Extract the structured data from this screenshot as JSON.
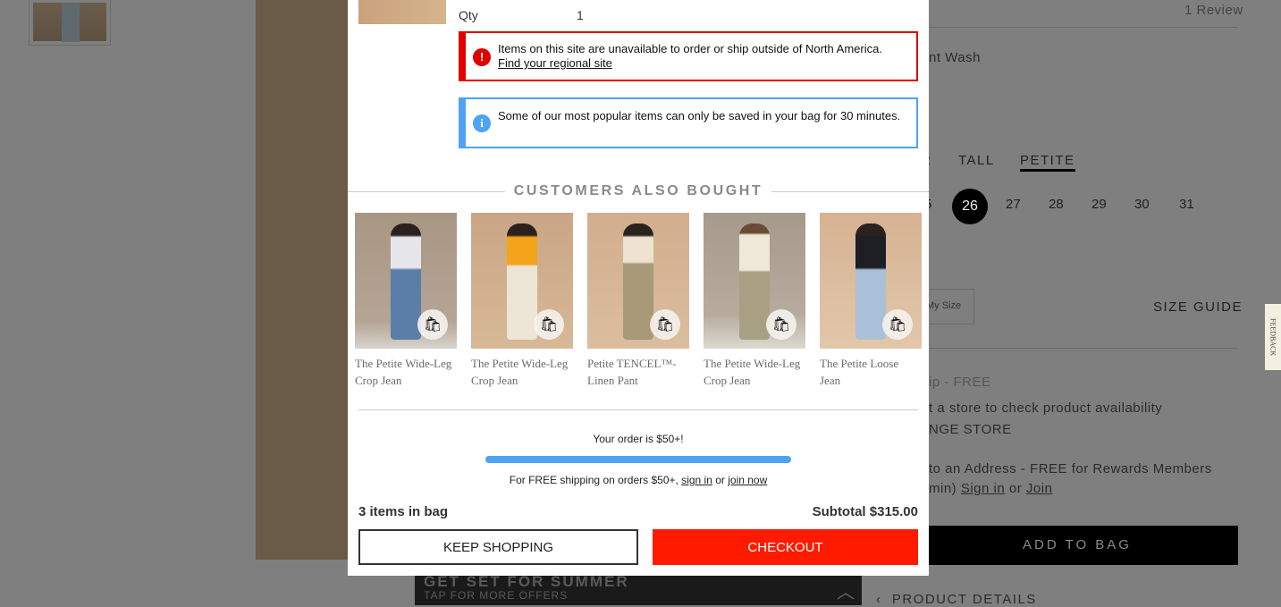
{
  "background": {
    "review": "1 Review",
    "color_name": "nt Wash",
    "fit_tabs": [
      "R",
      "TALL",
      "PETITE"
    ],
    "selected_fit": "PETITE",
    "sizes": [
      "5",
      "26",
      "27",
      "28",
      "29",
      "30",
      "31"
    ],
    "selected_size": "26",
    "find_my_size": "My Size",
    "size_guide": "SIZE GUIDE",
    "pickup": "ip - FREE",
    "store_line": "t a store to check product availability",
    "change_store": "NGE STORE",
    "ship_line": "to an Address - FREE for Rewards Members",
    "ship_line2_prefix": "min)",
    "sign_in": "Sign in",
    "or": "or",
    "join": "Join",
    "add_to_bag": "ADD TO BAG",
    "product_details": "PRODUCT DETAILS",
    "feedback": "FEEDBACK",
    "promo_title": "GET SET FOR SUMMER",
    "promo_sub": "TAP FOR MORE OFFERS"
  },
  "modal": {
    "qty_label": "Qty",
    "qty_value": "1",
    "error_alert": {
      "text": "Items on this site are unavailable to order or ship outside of North America.",
      "link": "Find your regional site",
      "color": "#e00000"
    },
    "info_alert": {
      "text": "Some of our most popular items can only be saved in your bag for 30 minutes.",
      "color": "#4da3f5"
    },
    "also_bought_title": "CUSTOMERS ALSO BOUGHT",
    "products": [
      {
        "name": "The Petite Wide-Leg Crop Jean"
      },
      {
        "name": "The Petite Wide-Leg Crop Jean"
      },
      {
        "name": "Petite TENCEL™-Linen Pant"
      },
      {
        "name": "The Petite Wide-Leg Crop Jean"
      },
      {
        "name": "The Petite Loose Jean"
      }
    ],
    "order_message": "Your order is $50+!",
    "shipping_progress_percent": 100,
    "shipping_prefix": "For FREE shipping on orders $50+,",
    "sign_in": "sign in",
    "or": "or",
    "join_now": "join now",
    "items_in_bag": "3 items in bag",
    "subtotal": "Subtotal $315.00",
    "keep_shopping": "KEEP SHOPPING",
    "checkout": "CHECKOUT",
    "checkout_color": "#ff1a00"
  }
}
